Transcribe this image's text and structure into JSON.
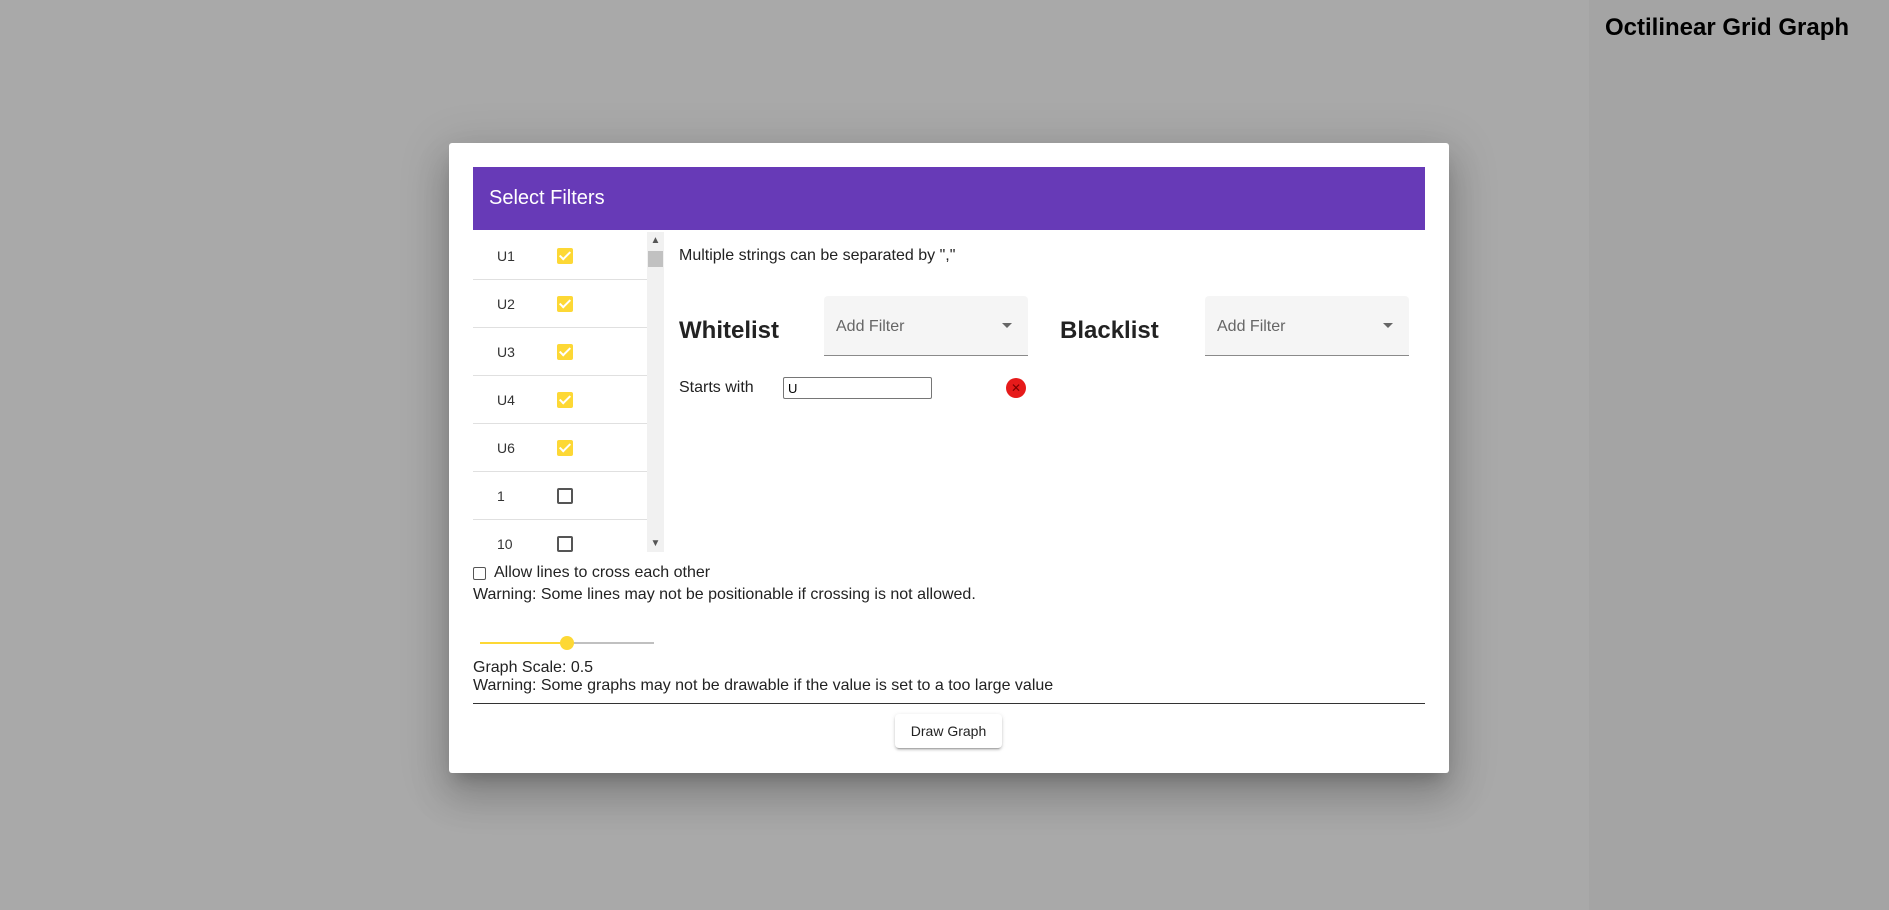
{
  "side_panel": {
    "title": "Octilinear Grid Graph"
  },
  "dialog": {
    "title": "Select Filters",
    "accent_color": "#673ab7",
    "checkbox_color": "#fdd835",
    "filter_list": [
      {
        "label": "U1",
        "checked": true
      },
      {
        "label": "U2",
        "checked": true
      },
      {
        "label": "U3",
        "checked": true
      },
      {
        "label": "U4",
        "checked": true
      },
      {
        "label": "U6",
        "checked": true
      },
      {
        "label": "1",
        "checked": false
      },
      {
        "label": "10",
        "checked": false
      }
    ],
    "hint": "Multiple strings can be separated by \",\"",
    "whitelist": {
      "heading": "Whitelist",
      "select_placeholder": "Add Filter",
      "rules": [
        {
          "label": "Starts with",
          "value": "U",
          "remove_icon": "close-icon"
        }
      ]
    },
    "blacklist": {
      "heading": "Blacklist",
      "select_placeholder": "Add Filter"
    },
    "crossing": {
      "label": "Allow lines to cross each other",
      "checked": false,
      "warning": "Warning: Some lines may not be positionable if crossing is not allowed."
    },
    "scale": {
      "value": 0.5,
      "label": "Graph Scale: 0.5",
      "warning": "Warning: Some graphs may not be drawable if the value is set to a too large value"
    },
    "draw_button": "Draw Graph"
  }
}
